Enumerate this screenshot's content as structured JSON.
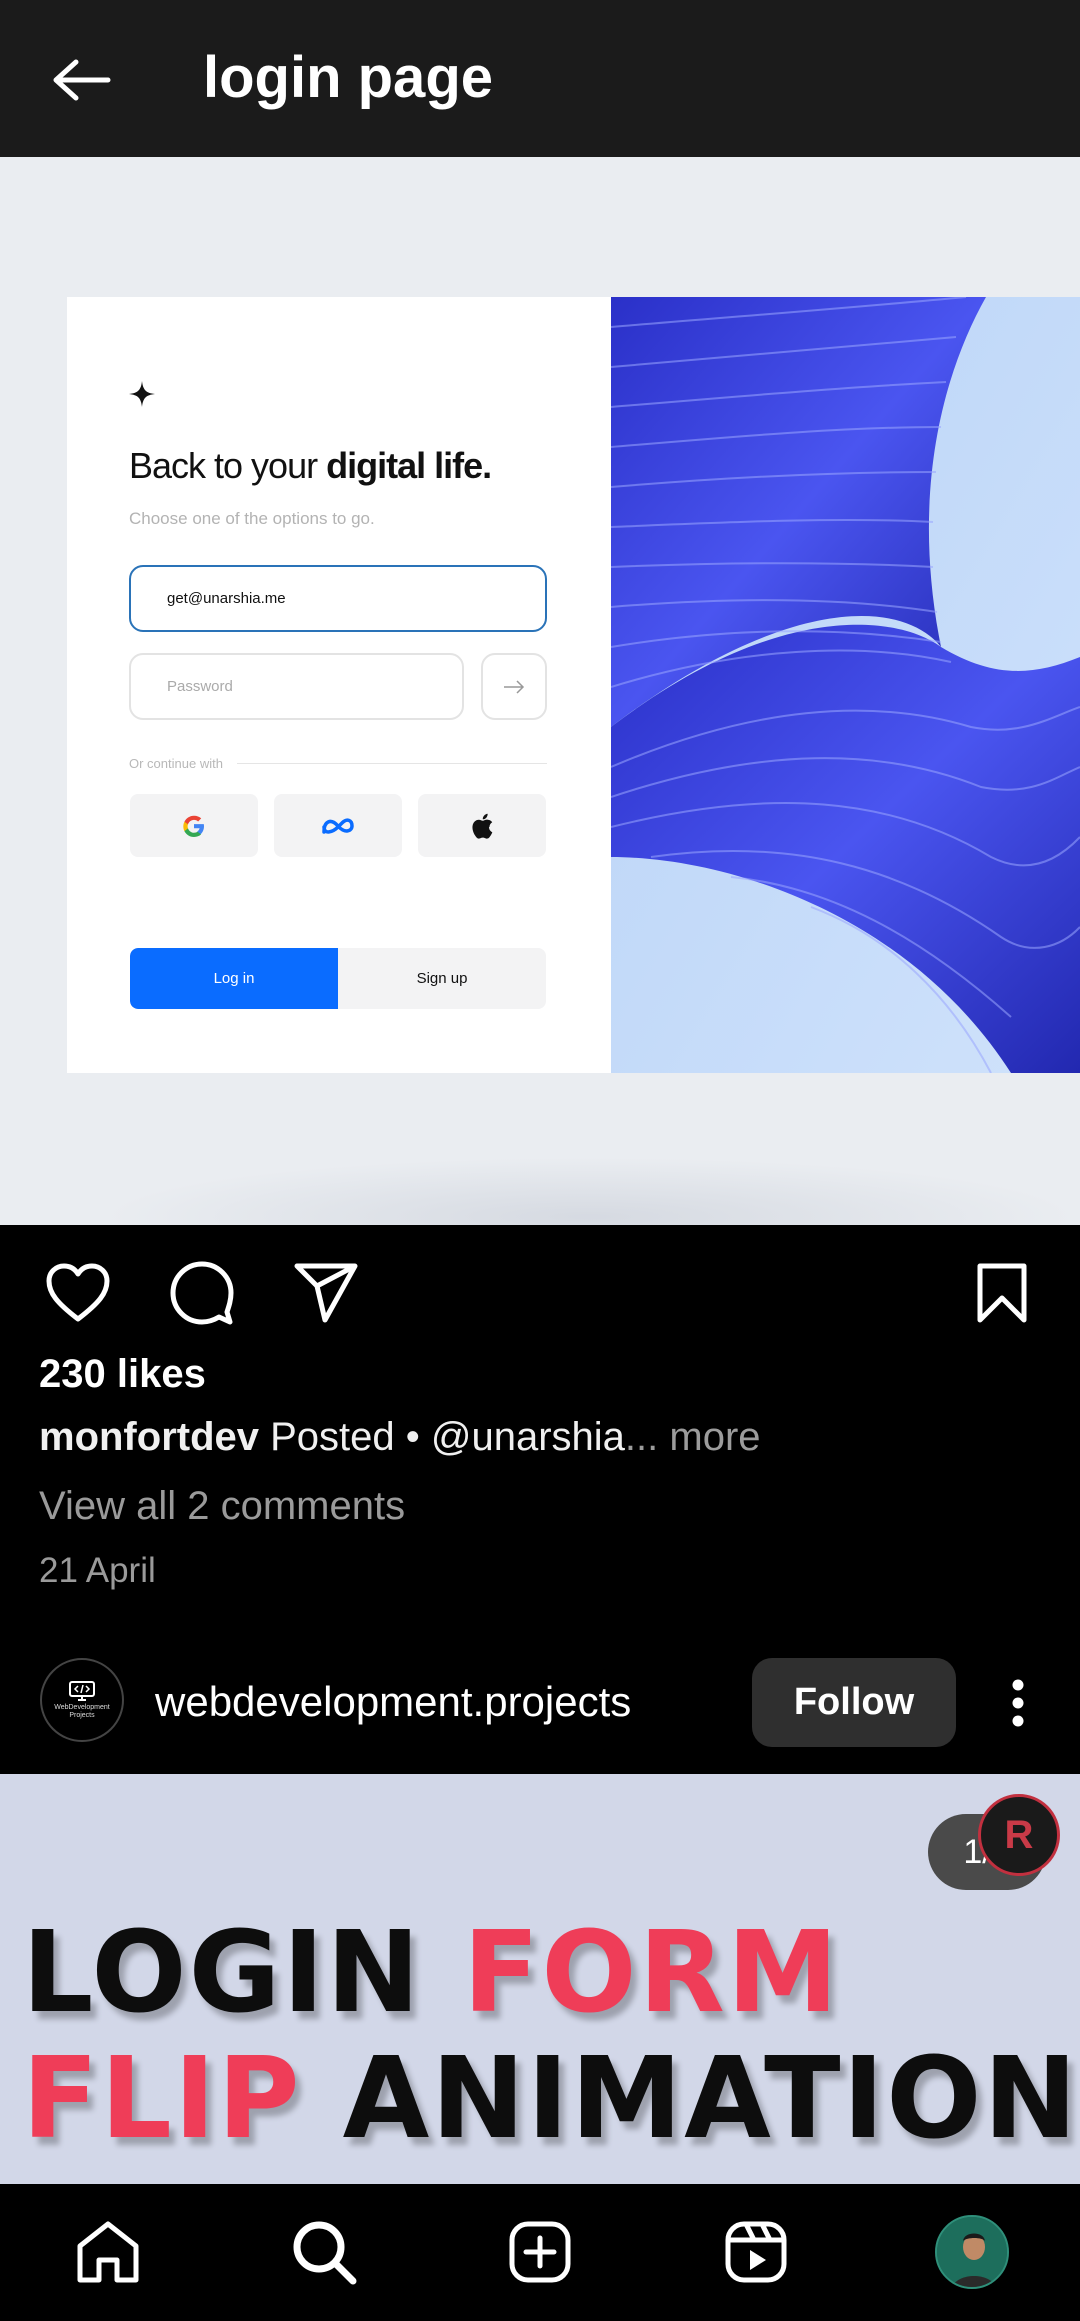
{
  "header": {
    "title": "login page",
    "back_icon": "arrow-left-icon"
  },
  "post": {
    "image": {
      "heading_light": "Back to your ",
      "heading_bold": "digital life.",
      "subtitle": "Choose one of the options to go.",
      "email_value": "get@unarshia.me",
      "password_placeholder": "Password",
      "divider_label": "Or continue with",
      "social": [
        "google-icon",
        "meta-icon",
        "apple-icon"
      ],
      "login_tab": "Log in",
      "signup_tab": "Sign up",
      "accent_color": "#0a6cff",
      "art_color": "#3b3fd9"
    },
    "actions": [
      "heart-icon",
      "comment-icon",
      "share-icon",
      "bookmark-icon"
    ],
    "likes": "230 likes",
    "caption_user": "monfortdev",
    "caption_text": " Posted • @unarshia",
    "caption_more": "... more",
    "comments_link": "View all 2 comments",
    "date": "21 April"
  },
  "next_post": {
    "avatar_text": "WebDevelopment Projects",
    "username": "webdevelopment.projects",
    "follow_label": "Follow",
    "counter": "1/9",
    "badge_letter": "R",
    "line1_a": "LOGIN ",
    "line1_b": "FORM",
    "line2_a": "FLIP ",
    "line2_b": "ANIMATION"
  },
  "bottom_nav": [
    "home-icon",
    "search-icon",
    "create-icon",
    "reels-icon",
    "profile-avatar"
  ]
}
